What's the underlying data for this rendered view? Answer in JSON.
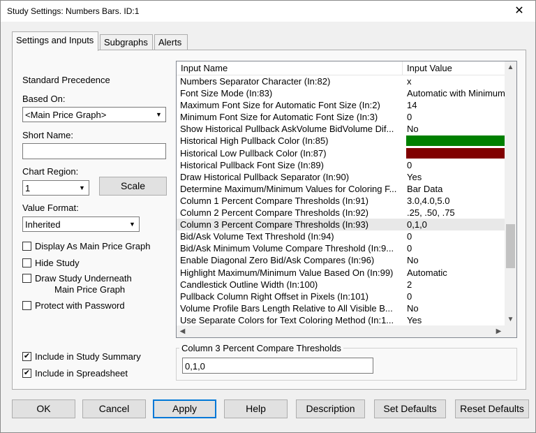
{
  "window": {
    "title": "Study Settings: Numbers Bars. ID:1",
    "close_glyph": "✕"
  },
  "tabs": [
    {
      "label": "Settings and Inputs",
      "active": true
    },
    {
      "label": "Subgraphs",
      "active": false
    },
    {
      "label": "Alerts",
      "active": false
    }
  ],
  "left": {
    "standard_precedence": "Standard Precedence",
    "based_on_label": "Based On:",
    "based_on_value": "<Main Price Graph>",
    "short_name_label": "Short Name:",
    "short_name_value": "",
    "chart_region_label": "Chart Region:",
    "chart_region_value": "1",
    "scale_button": "Scale",
    "value_format_label": "Value Format:",
    "value_format_value": "Inherited",
    "checks": {
      "display_main": {
        "label": "Display As Main Price Graph",
        "checked": false
      },
      "hide_study": {
        "label": "Hide Study",
        "checked": false
      },
      "draw_under_1": "Draw Study Underneath",
      "draw_under_2": "Main Price Graph",
      "protect": {
        "label": "Protect with Password",
        "checked": false
      },
      "include_summary": {
        "label": "Include in Study Summary",
        "checked": true
      },
      "include_spreadsheet": {
        "label": "Include in Spreadsheet",
        "checked": true
      }
    },
    "check_glyph": "✔"
  },
  "grid": {
    "headers": {
      "name": "Input Name",
      "value": "Input Value"
    },
    "rows": [
      {
        "name": "Numbers Separator Character  (In:82)",
        "value": "x"
      },
      {
        "name": "Font Size Mode  (In:83)",
        "value": "Automatic with Minimum"
      },
      {
        "name": "Maximum Font Size for Automatic Font Size  (In:2)",
        "value": "14"
      },
      {
        "name": "Minimum Font Size for Automatic Font Size  (In:3)",
        "value": "0"
      },
      {
        "name": "Show Historical Pullback AskVolume BidVolume Dif...",
        "value": "No"
      },
      {
        "name": "Historical High Pullback Color  (In:85)",
        "value": "R: 0, G: 128, B: 0",
        "bg": "#008000"
      },
      {
        "name": "Historical Low Pullback Color  (In:87)",
        "value": "R: 128, G: 0, B: 0",
        "bg": "#800000"
      },
      {
        "name": "Historical Pullback Font Size  (In:89)",
        "value": "0"
      },
      {
        "name": "Draw Historical Pullback Separator  (In:90)",
        "value": "Yes"
      },
      {
        "name": "Determine Maximum/Minimum Values for Coloring F...",
        "value": "Bar Data"
      },
      {
        "name": "Column 1 Percent Compare Thresholds  (In:91)",
        "value": "3.0,4.0,5.0"
      },
      {
        "name": "Column 2 Percent Compare Thresholds  (In:92)",
        "value": ".25, .50, .75"
      },
      {
        "name": "Column 3 Percent Compare Thresholds  (In:93)",
        "value": "0,1,0",
        "selected": true
      },
      {
        "name": "Bid/Ask Volume Text Threshold  (In:94)",
        "value": "0"
      },
      {
        "name": "Bid/Ask Minimum Volume Compare Threshold  (In:9...",
        "value": "0"
      },
      {
        "name": "Enable Diagonal Zero Bid/Ask Compares  (In:96)",
        "value": "No"
      },
      {
        "name": "Highlight Maximum/Minimum Value Based On  (In:99)",
        "value": "Automatic"
      },
      {
        "name": "Candlestick Outline Width  (In:100)",
        "value": "2"
      },
      {
        "name": "Pullback Column Right Offset in Pixels  (In:101)",
        "value": "0"
      },
      {
        "name": "Volume Profile Bars Length Relative to All Visible B...",
        "value": "No"
      },
      {
        "name": "Use Separate Colors for Text Coloring Method  (In:1...",
        "value": "Yes"
      }
    ]
  },
  "edit_group": {
    "title": "Column 3 Percent Compare Thresholds",
    "value": "0,1,0"
  },
  "buttons": {
    "ok": "OK",
    "cancel": "Cancel",
    "apply": "Apply",
    "help": "Help",
    "description": "Description",
    "set_defaults": "Set Defaults",
    "reset_defaults": "Reset Defaults"
  },
  "icons": {
    "dropdown": "▼",
    "scroll_up": "▲",
    "scroll_down": "▼",
    "scroll_left": "◀",
    "scroll_right": "▶"
  },
  "colors": {
    "accent": "#0078d7",
    "high_pullback": "#008000",
    "low_pullback": "#800000"
  }
}
